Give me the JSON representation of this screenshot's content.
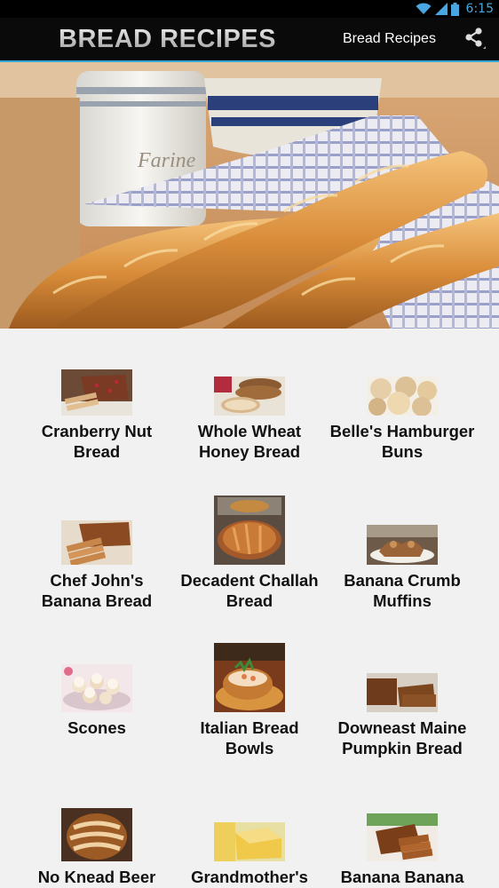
{
  "status_bar": {
    "time": "6:15",
    "icons": [
      "wifi-icon",
      "signal-icon",
      "battery-icon"
    ]
  },
  "action_bar": {
    "logo_text": "BREAD RECIPES",
    "title": "Bread Recipes",
    "share_icon": "share-icon"
  },
  "hero": {
    "jar_text": "Farine"
  },
  "recipes": [
    {
      "label": "Cranberry Nut Bread",
      "thumb": "sliced-loaf"
    },
    {
      "label": "Whole Wheat Honey Bread",
      "thumb": "sliced-loaf"
    },
    {
      "label": "Belle's Hamburger Buns",
      "thumb": "buns"
    },
    {
      "label": "Chef John's Banana Bread",
      "thumb": "sliced-loaf"
    },
    {
      "label": "Decadent Challah Bread",
      "thumb": "challah"
    },
    {
      "label": "Banana Crumb Muffins",
      "thumb": "muffins"
    },
    {
      "label": "Scones",
      "thumb": "scones"
    },
    {
      "label": "Italian Bread Bowls",
      "thumb": "bread-bowl"
    },
    {
      "label": "Downeast Maine Pumpkin Bread",
      "thumb": "sliced-loaf"
    },
    {
      "label": "No Knead Beer",
      "thumb": "round-loaf"
    },
    {
      "label": "Grandmother's",
      "thumb": "cornbread"
    },
    {
      "label": "Banana Banana",
      "thumb": "sliced-loaf"
    }
  ]
}
